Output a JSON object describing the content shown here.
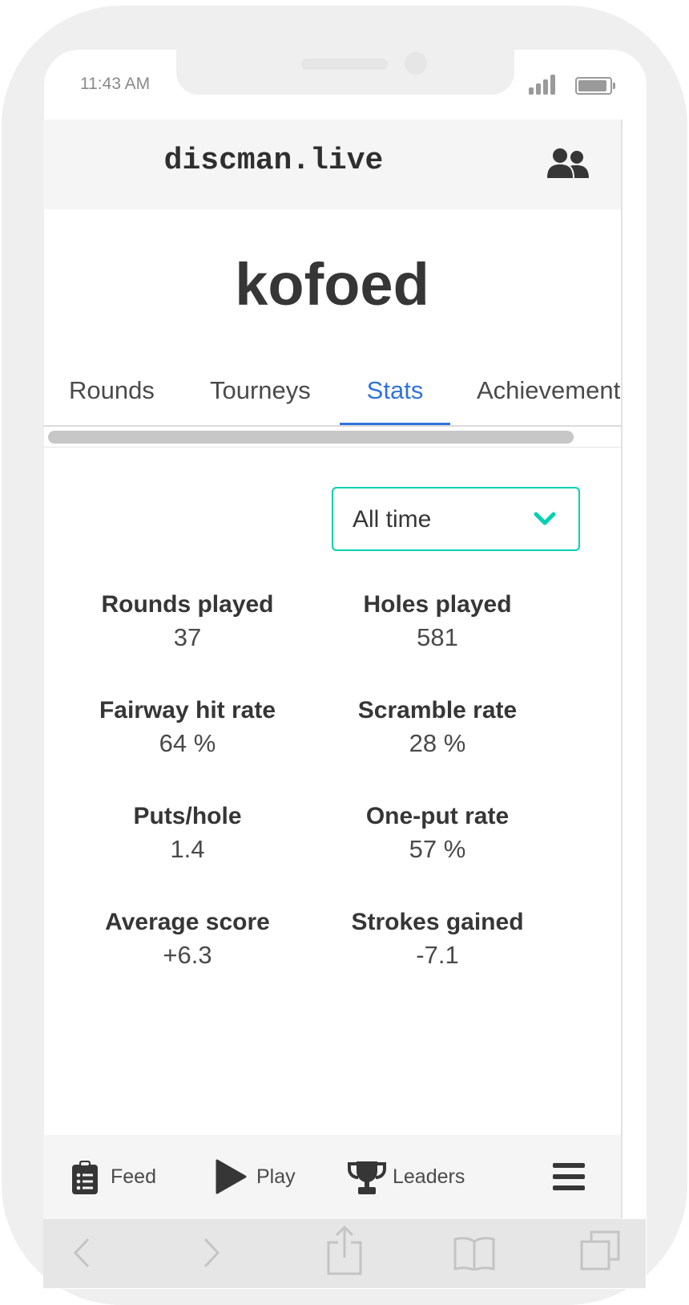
{
  "status_bar": {
    "time": "11:43 AM"
  },
  "header": {
    "brand": "discman.live",
    "users_icon": "users-icon"
  },
  "profile": {
    "name": "kofoed"
  },
  "tabs": [
    {
      "label": "Rounds",
      "active": false
    },
    {
      "label": "Tourneys",
      "active": false
    },
    {
      "label": "Stats",
      "active": true
    },
    {
      "label": "Achievement",
      "active": false
    }
  ],
  "period_select": {
    "value": "All time",
    "icon": "chevron-down-icon"
  },
  "stats": [
    {
      "label": "Rounds played",
      "value": "37"
    },
    {
      "label": "Holes played",
      "value": "581"
    },
    {
      "label": "Fairway hit rate",
      "value": "64 %"
    },
    {
      "label": "Scramble rate",
      "value": "28 %"
    },
    {
      "label": "Puts/hole",
      "value": "1.4"
    },
    {
      "label": "One-put rate",
      "value": "57 %"
    },
    {
      "label": "Average score",
      "value": "+6.3"
    },
    {
      "label": "Strokes gained",
      "value": "-7.1"
    }
  ],
  "bottom_nav": [
    {
      "label": "Feed",
      "icon": "clipboard-list-icon"
    },
    {
      "label": "Play",
      "icon": "play-icon"
    },
    {
      "label": "Leaders",
      "icon": "trophy-icon"
    },
    {
      "label": "",
      "icon": "hamburger-menu-icon"
    }
  ],
  "colors": {
    "accent": "#3273dc",
    "select_border": "#00d1b2",
    "text": "#363636"
  }
}
